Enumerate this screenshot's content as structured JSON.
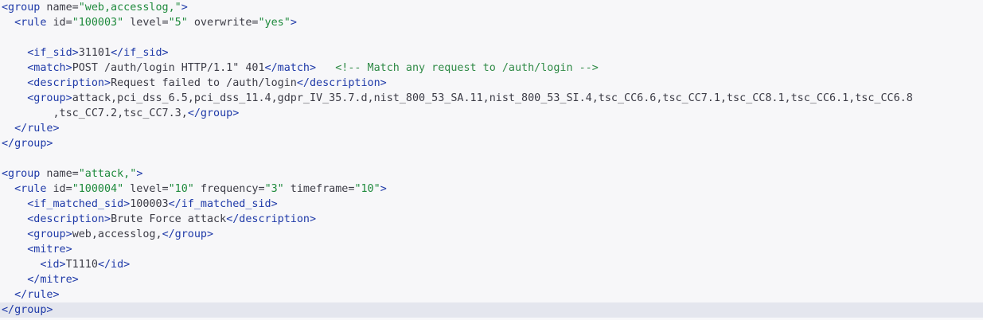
{
  "code_lines": [
    {
      "indent": "",
      "parts": [
        [
          "tag",
          "<group"
        ],
        [
          "attr",
          " name="
        ],
        [
          "val",
          "\"web,accesslog,\""
        ],
        [
          "tag",
          ">"
        ]
      ]
    },
    {
      "indent": "  ",
      "parts": [
        [
          "tag",
          "<rule"
        ],
        [
          "attr",
          " id="
        ],
        [
          "val",
          "\"100003\""
        ],
        [
          "attr",
          " level="
        ],
        [
          "val",
          "\"5\""
        ],
        [
          "attr",
          " overwrite="
        ],
        [
          "val",
          "\"yes\""
        ],
        [
          "tag",
          ">"
        ]
      ]
    },
    {
      "indent": "",
      "parts": []
    },
    {
      "indent": "    ",
      "parts": [
        [
          "tag",
          "<if_sid>"
        ],
        [
          "txt",
          "31101"
        ],
        [
          "tag",
          "</if_sid>"
        ]
      ]
    },
    {
      "indent": "    ",
      "parts": [
        [
          "tag",
          "<match>"
        ],
        [
          "txt",
          "POST /auth/login HTTP/1.1\" 401"
        ],
        [
          "tag",
          "</match>"
        ],
        [
          "txt",
          "   "
        ],
        [
          "cmt",
          "<!-- Match any request to /auth/login -->"
        ]
      ]
    },
    {
      "indent": "    ",
      "parts": [
        [
          "tag",
          "<description>"
        ],
        [
          "txt",
          "Request failed to /auth/login"
        ],
        [
          "tag",
          "</description>"
        ]
      ]
    },
    {
      "indent": "    ",
      "parts": [
        [
          "tag",
          "<group>"
        ],
        [
          "txt",
          "attack,pci_dss_6.5,pci_dss_11.4,gdpr_IV_35.7.d,nist_800_53_SA.11,nist_800_53_SI.4,tsc_CC6.6,tsc_CC7.1,tsc_CC8.1,tsc_CC6.1,tsc_CC6.8"
        ]
      ]
    },
    {
      "indent": "        ",
      "parts": [
        [
          "txt",
          ",tsc_CC7.2,tsc_CC7.3,"
        ],
        [
          "tag",
          "</group>"
        ]
      ]
    },
    {
      "indent": "  ",
      "parts": [
        [
          "tag",
          "</rule>"
        ]
      ]
    },
    {
      "indent": "",
      "parts": [
        [
          "tag",
          "</group>"
        ]
      ]
    },
    {
      "indent": "",
      "parts": []
    },
    {
      "indent": "",
      "parts": [
        [
          "tag",
          "<group"
        ],
        [
          "attr",
          " name="
        ],
        [
          "val",
          "\"attack,\""
        ],
        [
          "tag",
          ">"
        ]
      ]
    },
    {
      "indent": "  ",
      "parts": [
        [
          "tag",
          "<rule"
        ],
        [
          "attr",
          " id="
        ],
        [
          "val",
          "\"100004\""
        ],
        [
          "attr",
          " level="
        ],
        [
          "val",
          "\"10\""
        ],
        [
          "attr",
          " frequency="
        ],
        [
          "val",
          "\"3\""
        ],
        [
          "attr",
          " timeframe="
        ],
        [
          "val",
          "\"10\""
        ],
        [
          "tag",
          ">"
        ]
      ]
    },
    {
      "indent": "    ",
      "parts": [
        [
          "tag",
          "<if_matched_sid>"
        ],
        [
          "txt",
          "100003"
        ],
        [
          "tag",
          "</if_matched_sid>"
        ]
      ]
    },
    {
      "indent": "    ",
      "parts": [
        [
          "tag",
          "<description>"
        ],
        [
          "txt",
          "Brute Force attack"
        ],
        [
          "tag",
          "</description>"
        ]
      ]
    },
    {
      "indent": "    ",
      "parts": [
        [
          "tag",
          "<group>"
        ],
        [
          "txt",
          "web,accesslog,"
        ],
        [
          "tag",
          "</group>"
        ]
      ]
    },
    {
      "indent": "    ",
      "parts": [
        [
          "tag",
          "<mitre>"
        ]
      ]
    },
    {
      "indent": "      ",
      "parts": [
        [
          "tag",
          "<id>"
        ],
        [
          "txt",
          "T1110"
        ],
        [
          "tag",
          "</id>"
        ]
      ]
    },
    {
      "indent": "    ",
      "parts": [
        [
          "tag",
          "</mitre>"
        ]
      ]
    },
    {
      "indent": "  ",
      "parts": [
        [
          "tag",
          "</rule>"
        ]
      ]
    },
    {
      "indent": "",
      "parts": [
        [
          "tag",
          "</group>"
        ]
      ],
      "highlight": true
    }
  ]
}
